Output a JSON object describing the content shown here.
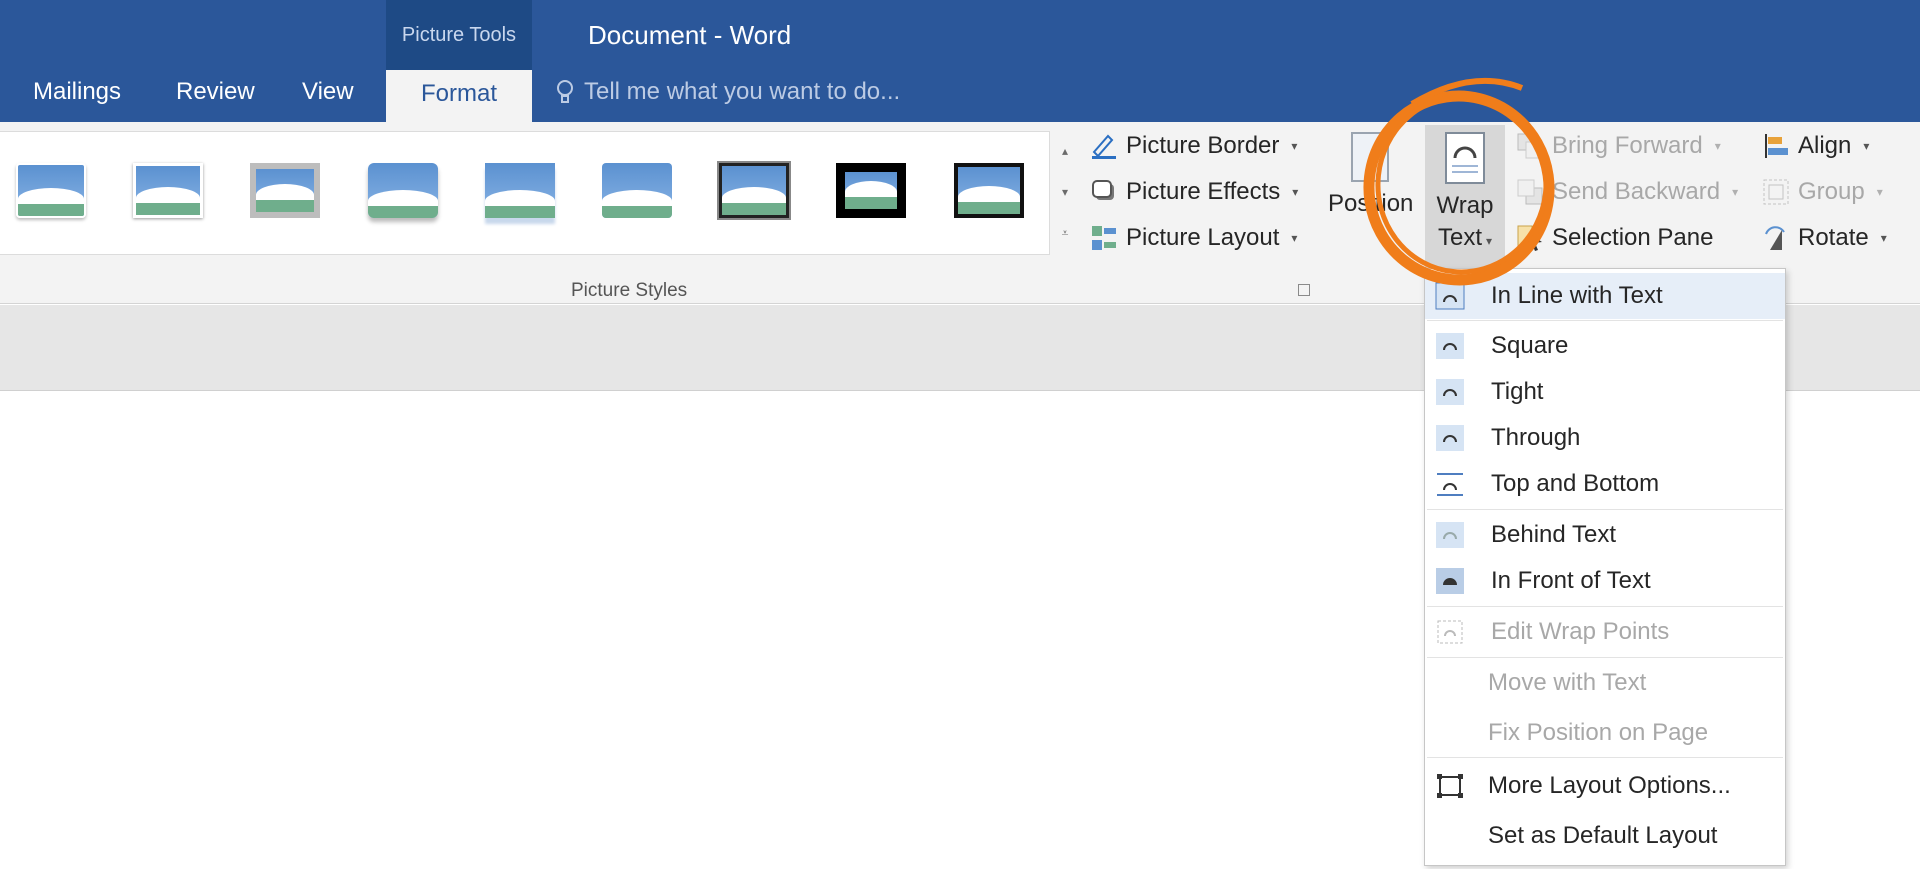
{
  "window": {
    "context_group": "Picture Tools",
    "title": "Document  - Word"
  },
  "tabs": [
    {
      "label": "Mailings",
      "active": false
    },
    {
      "label": "Review",
      "active": false
    },
    {
      "label": "View",
      "active": false
    },
    {
      "label": "Format",
      "active": true
    }
  ],
  "tell_me": {
    "placeholder": "Tell me what you want to do..."
  },
  "ribbon": {
    "picture_styles": {
      "label": "Picture Styles",
      "styles_count": 9
    },
    "picture_format": {
      "border": "Picture Border",
      "effects": "Picture Effects",
      "layout": "Picture Layout"
    },
    "arrange": {
      "position_label": "Position",
      "wrap_label_1": "Wrap",
      "wrap_label_2": "Text",
      "bring_forward": "Bring Forward",
      "send_backward": "Send Backward",
      "selection_pane": "Selection Pane",
      "align": "Align",
      "group": "Group",
      "rotate": "Rotate"
    }
  },
  "wrap_menu": {
    "items": [
      {
        "label": "In Line with Text",
        "enabled": true,
        "selected": true
      },
      {
        "label": "Square",
        "enabled": true
      },
      {
        "label": "Tight",
        "enabled": true
      },
      {
        "label": "Through",
        "enabled": true
      },
      {
        "label": "Top and Bottom",
        "enabled": true
      },
      {
        "label": "Behind Text",
        "enabled": true
      },
      {
        "label": "In Front of Text",
        "enabled": true
      },
      {
        "label": "Edit Wrap Points",
        "enabled": false
      },
      {
        "label": "Move with Text",
        "enabled": false
      },
      {
        "label": "Fix Position on Page",
        "enabled": false
      },
      {
        "label": "More Layout Options...",
        "enabled": true
      },
      {
        "label": "Set as Default Layout",
        "enabled": true
      }
    ]
  },
  "colors": {
    "title_bar": "#2b579a",
    "ribbon": "#f3f3f3",
    "highlight_ring": "#f07d1a"
  }
}
